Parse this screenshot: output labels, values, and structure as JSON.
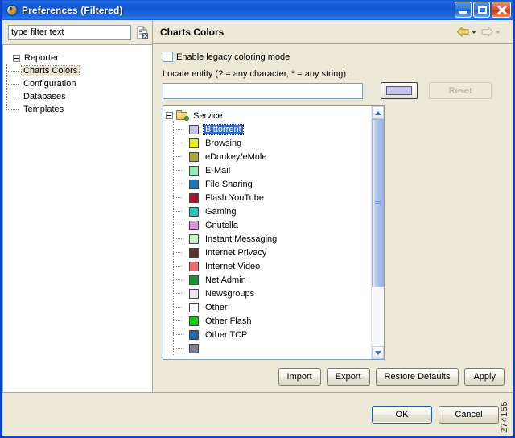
{
  "window": {
    "title": "Preferences (Filtered)",
    "icon": "eclipse-icon",
    "minimize_label": "Minimize",
    "maximize_label": "Maximize",
    "close_label": "Close"
  },
  "filter": {
    "value": "type filter text",
    "placeholder": "type filter text",
    "clear_icon": "clear-filter-icon"
  },
  "nav_tree": {
    "root": {
      "label": "Reporter",
      "expanded": true
    },
    "items": [
      {
        "label": "Charts Colors",
        "selected": true
      },
      {
        "label": "Configuration",
        "selected": false
      },
      {
        "label": "Databases",
        "selected": false
      },
      {
        "label": "Templates",
        "selected": false
      }
    ]
  },
  "page": {
    "title": "Charts Colors",
    "back_label": "Back",
    "forward_label": "Forward",
    "legacy_checkbox": {
      "label": "Enable legacy coloring mode",
      "checked": false
    },
    "locate_label": "Locate entity (? = any character, * = any string):",
    "locate_value": "",
    "color_button": {
      "label": "",
      "swatch_color": "#c6c0ef"
    },
    "reset_label": "Reset",
    "buttons": [
      {
        "label": "Import",
        "enabled": true
      },
      {
        "label": "Export",
        "enabled": true
      },
      {
        "label": "Restore Defaults",
        "enabled": true
      },
      {
        "label": "Apply",
        "enabled": true
      }
    ]
  },
  "service_tree": {
    "root_label": "Service",
    "root_icon": "folder-icon",
    "expanded": true,
    "items": [
      {
        "label": "Bittorrent",
        "color": "#c9c2ec",
        "selected": true
      },
      {
        "label": "Browsing",
        "color": "#eded18",
        "selected": false
      },
      {
        "label": "eDonkey/eMule",
        "color": "#a8a93a",
        "selected": false
      },
      {
        "label": "E-Mail",
        "color": "#93ebb4",
        "selected": false
      },
      {
        "label": "File Sharing",
        "color": "#1878b8",
        "selected": false
      },
      {
        "label": "Flash YouTube",
        "color": "#a81530",
        "selected": false
      },
      {
        "label": "Gaming",
        "color": "#2ec3bd",
        "selected": false
      },
      {
        "label": "Gnutella",
        "color": "#dd93dd",
        "selected": false
      },
      {
        "label": "Instant Messaging",
        "color": "#c9f5c9",
        "selected": false
      },
      {
        "label": "Internet Privacy",
        "color": "#5a3030",
        "selected": false
      },
      {
        "label": "Internet Video",
        "color": "#f56a6a",
        "selected": false
      },
      {
        "label": "Net Admin",
        "color": "#17962e",
        "selected": false
      },
      {
        "label": "Newsgroups",
        "color": "#f2e0ef",
        "selected": false
      },
      {
        "label": "Other",
        "color": "#eda濃65",
        "selected": false
      },
      {
        "label": "Other Flash",
        "color": "#12cc12",
        "selected": false
      },
      {
        "label": "Other TCP",
        "color": "#2466a8",
        "selected": false
      },
      {
        "label": "",
        "color": "#7a7f8f",
        "selected": false
      }
    ],
    "scrollbar": {
      "thumb_percent": 74
    }
  },
  "footer": {
    "ok_label": "OK",
    "cancel_label": "Cancel"
  },
  "watermark": "274155"
}
